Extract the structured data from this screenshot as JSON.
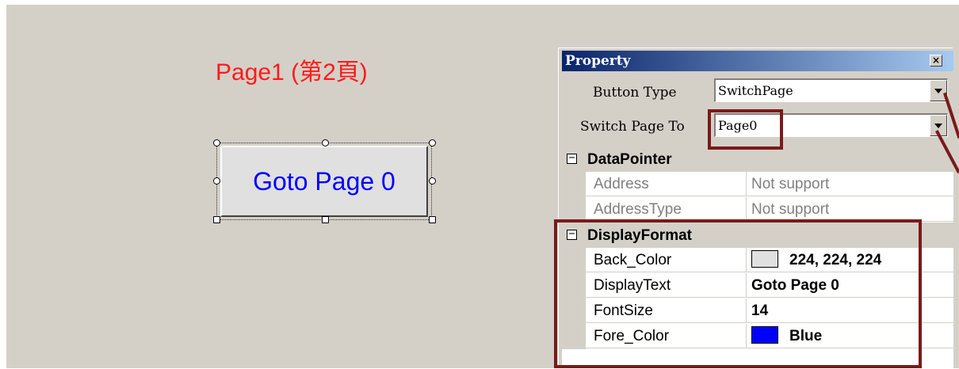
{
  "canvas": {
    "page_title": "Page1 (第2頁)",
    "selected_button": {
      "text": "Goto Page 0",
      "back_color": "#e0e0e0",
      "fore_color": "#0000ff"
    }
  },
  "property_window": {
    "title": "Property",
    "close_label": "×",
    "button_type": {
      "label": "Button Type",
      "value": "SwitchPage"
    },
    "switch_page": {
      "label": "Switch Page To",
      "value": "Page0"
    },
    "categories": [
      {
        "name": "DataPointer",
        "toggle": "−",
        "rows": [
          {
            "name": "Address",
            "value": "Not support"
          },
          {
            "name": "AddressType",
            "value": "Not support"
          }
        ]
      },
      {
        "name": "DisplayFormat",
        "toggle": "−",
        "rows": [
          {
            "name": "Back_Color",
            "value": "224, 224, 224",
            "swatch": "#e0e0e0"
          },
          {
            "name": "DisplayText",
            "value": "Goto Page 0"
          },
          {
            "name": "FontSize",
            "value": "14"
          },
          {
            "name": "Fore_Color",
            "value": "Blue",
            "swatch": "#0000ff"
          }
        ]
      }
    ]
  },
  "colors": {
    "canvas_bg": "#d4d0c8",
    "title_text": "#ff1a1a",
    "title_bar_start": "#0a246a",
    "highlight": "#7a1a1a"
  }
}
